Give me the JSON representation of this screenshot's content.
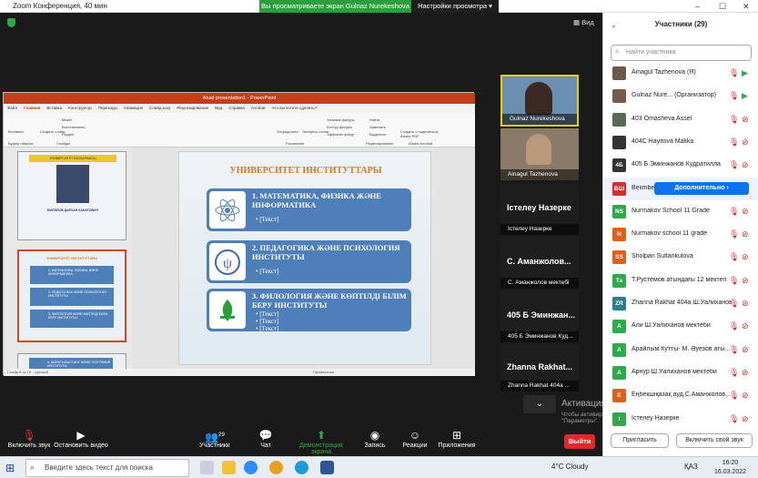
{
  "titlebar": {
    "title": "Zoom Конференция, 40 мин"
  },
  "banner": {
    "text": "Вы просматриваете экран Gulnaz Nurekeshova",
    "view_options": "Настройки просмотра"
  },
  "share": {
    "view_label": "Вид"
  },
  "ppt": {
    "title": "Atual presentation1 - PowerPoint",
    "tabs": [
      "Файл",
      "Главная",
      "Вставка",
      "Конструктор",
      "Переходы",
      "Анимация",
      "Слайд-шоу",
      "Рецензирование",
      "Вид",
      "Справка",
      "Acrobat",
      "Что вы хотите сделать?"
    ],
    "ribbon": {
      "paste": "Вставить",
      "clipboard": "Буфер обмена",
      "create_slide": "Создать слайд",
      "slides": "Слайды",
      "layout": "Макет",
      "reset": "Восстановить",
      "section": "Раздел",
      "drawing": "Рисование",
      "editing": "Редактирование",
      "find": "Найти",
      "replace": "Заменить",
      "select": "Выделить",
      "create_pdf": "Создать и поделиться Adobe PDF",
      "acrobat": "Adobe Acrobat",
      "fill": "Заливка фигуры",
      "outline": "Контур фигуры",
      "effects": "Эффекты фигур",
      "arrange": "Упорядочить",
      "quick_styles": "Экспресс-стили"
    },
    "slide1": {
      "head": "УНИВЕРСИТЕТ БАСҚАРМАСЫ",
      "name": "БИЛЯЛОВ ДАРХАН КАНАТОВИЧ"
    },
    "slide3": {
      "text": "4. ЖАРАТЫЛЫСТАНУ ЖӘНЕ ГЕОГРАФИЯ ИНСТИТУТЫ"
    },
    "slide": {
      "title": "УНИВЕРСИТЕТ ИНСТИТУТТАРЫ",
      "boxes": [
        {
          "title": "1. МАТЕМАТИКА, ФИЗИКА ЖӘНЕ ИНФОРМАТИКА",
          "lines": [
            "• [Текст]"
          ]
        },
        {
          "title": "2. ПЕДАГОГИКА ЖӘНЕ ПСИХОЛОГИЯ ИНСТИТУТЫ",
          "lines": [
            "• [Текст]"
          ]
        },
        {
          "title": "3. ФИЛОЛОГИЯ ЖӘНЕ КӨПТІЛДІ БІЛІМ БЕРУ ИНСТИТУТЫ",
          "lines": [
            "• [Текст]",
            "• [Текст]",
            "• [Текст]"
          ]
        }
      ]
    },
    "status": {
      "slide": "Слайд 8 из 15",
      "lang": "русский",
      "notes": "Примечания"
    }
  },
  "videos": [
    {
      "label": "Gulnaz Nurekeshova"
    },
    {
      "label": "Ainagul Tazhenova"
    },
    {
      "name": "Істелеу Назерке",
      "label": "Істелеу Назерке"
    },
    {
      "name": "С. Аманжолов...",
      "label": "С. Аманжолов мектебі"
    },
    {
      "name": "405 Б Эминжан...",
      "label": "405 Б Эминжанов Куд..."
    },
    {
      "name": "Zhanna Rakhat...",
      "label": "Zhanna Rakhat 404a ..."
    }
  ],
  "watermark": {
    "line1": "Активация Windows",
    "line2": "Чтобы активировать Windows, перейдите в раздел \"Параметры\"."
  },
  "toolbar": {
    "mute": "Включить звук",
    "video": "Остановить видео",
    "participants": "Участники",
    "participants_count": "29",
    "chat": "Чат",
    "share": "Демонстрация экрана",
    "record": "Запись",
    "reactions": "Реакции",
    "apps": "Приложения",
    "end": "Выйти"
  },
  "panel": {
    "title": "Участники (29)",
    "search_placeholder": "Найти участника",
    "more": "Дополнительно ›",
    "invite": "Пригласить",
    "unmute_all": "Включить свой звук",
    "participants": [
      {
        "name": "Ainagul Tazhenova (Я)",
        "av": "",
        "color": "#6b5a4a"
      },
      {
        "name": "Gulnaz Nure... (Организатор)",
        "av": "",
        "color": "#7a5a4a"
      },
      {
        "name": "403 Omasheva Assel",
        "av": "",
        "color": "#5a6a5a"
      },
      {
        "name": "404C Hayitova Malika",
        "av": "",
        "color": "#333333"
      },
      {
        "name": "405 Б Эминжанов Кудратилла",
        "av": "4Б",
        "color": "#333333"
      },
      {
        "name": "Beiimbet Ш.Уалиханов",
        "av": "ВШ",
        "color": "#d32f2f"
      },
      {
        "name": "Nurmakov School 11 Grade",
        "av": "NS",
        "color": "#2eaa4a"
      },
      {
        "name": "Nurmakov school 11 grade",
        "av": "N",
        "color": "#e0601a"
      },
      {
        "name": "Sholpan Sultankulova",
        "av": "SS",
        "color": "#e0601a"
      },
      {
        "name": "Т.Рустемов атындағы 12 мектеп",
        "av": "Та",
        "color": "#2eaa4a"
      },
      {
        "name": "Zhanna Rakhat 404a Ш.Уалиханов",
        "av": "ZR",
        "color": "#2e7d8a"
      },
      {
        "name": "Али Ш.Уалиханов мектеби",
        "av": "А",
        "color": "#2eaa4a"
      },
      {
        "name": "Арайлым Кутты- М. Әуезов аты...",
        "av": "А",
        "color": "#2eaa4a"
      },
      {
        "name": "Арнур Ш.Уалиханов мектеби",
        "av": "А",
        "color": "#2eaa4a"
      },
      {
        "name": "Еңбекшіқазақ ауд.С.Аманжолов...",
        "av": "Е",
        "color": "#e0601a"
      },
      {
        "name": "Істелеу Назерке",
        "av": "І",
        "color": "#2eaa4a"
      }
    ]
  },
  "taskbar": {
    "search": "Введите здесь текст для поиска",
    "weather": "4°C Cloudy",
    "lang": "ҚАЗ",
    "time": "16:20",
    "date": "16.03.2022"
  }
}
